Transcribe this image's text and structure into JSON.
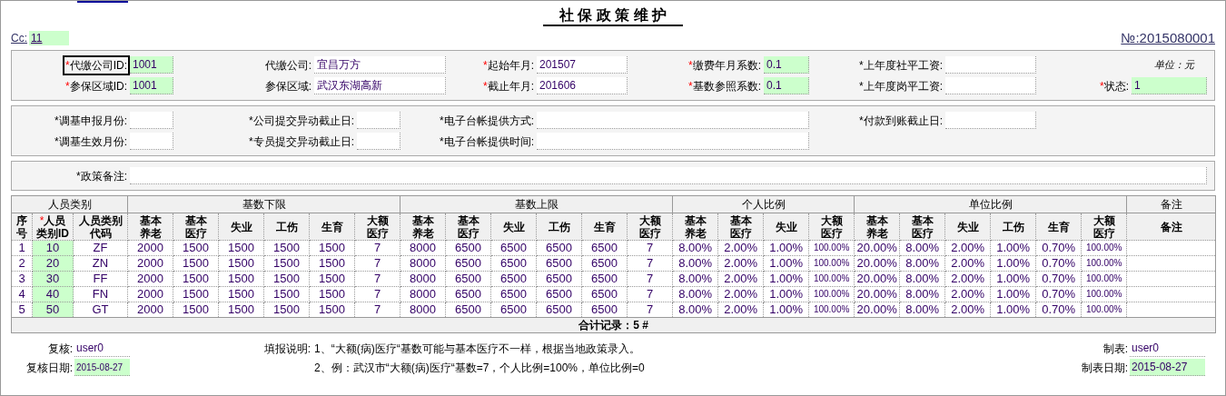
{
  "top_link_marker": true,
  "title": "社 保 政 策 维 护",
  "cc": {
    "label": "Cc:",
    "value": "11",
    "highlighted": true
  },
  "number": "№:2015080001",
  "sections": [
    {
      "unit_note": "单位：元",
      "rows": [
        [
          {
            "mark": "*",
            "required": true,
            "label": "代缴公司ID:",
            "value": "1001",
            "highlighted": true,
            "focused": true
          },
          {
            "label": "代缴公司:",
            "value": "宜昌万方",
            "highlighted": false,
            "focused": false
          },
          {
            "mark": "*",
            "required": true,
            "label": "起始年月:",
            "value": "201507",
            "highlighted": false,
            "focused": false
          },
          {
            "mark": "*",
            "required": true,
            "label": "缴费年月系数:",
            "value": "0.1",
            "highlighted": true,
            "focused": false
          },
          {
            "mark": "*",
            "required": false,
            "label": "上年度社平工资:",
            "highlighted": false,
            "focused": false
          }
        ],
        [
          {
            "mark": "*",
            "required": true,
            "label": "参保区域ID:",
            "value": "1001",
            "highlighted": true,
            "focused": false
          },
          {
            "label": "参保区域:",
            "value": "武汉东湖高新",
            "highlighted": false,
            "focused": false
          },
          {
            "mark": "*",
            "required": true,
            "label": "截止年月:",
            "value": "201606",
            "highlighted": false,
            "focused": false
          },
          {
            "mark": "*",
            "required": true,
            "label": "基数参照系数:",
            "value": "0.1",
            "highlighted": true,
            "focused": false
          },
          {
            "mark": "*",
            "required": false,
            "label": "上年度岗平工资:",
            "highlighted": false,
            "focused": false
          },
          {
            "mark": "*",
            "required": true,
            "label": "状态:",
            "value": "1",
            "highlighted": true,
            "focused": false
          }
        ]
      ]
    },
    {
      "rows": [
        [
          {
            "mark": "*",
            "required": false,
            "label": "调基申报月份:",
            "highlighted": false,
            "focused": false
          },
          {
            "mark": "*",
            "required": false,
            "label": "公司提交异动截止日:",
            "highlighted": false,
            "focused": false
          },
          {
            "mark": "*",
            "required": false,
            "label": "电子台帐提供方式:",
            "highlighted": false,
            "focused": false
          },
          {
            "mark": "*",
            "required": false,
            "label": "付款到账截止日:",
            "highlighted": false,
            "focused": false
          }
        ],
        [
          {
            "mark": "*",
            "required": false,
            "label": "调基生效月份:",
            "highlighted": false,
            "focused": false
          },
          {
            "mark": "*",
            "required": false,
            "label": "专员提交异动截止日:",
            "highlighted": false,
            "focused": false
          },
          {
            "mark": "*",
            "required": false,
            "label": "电子台帐提供时间:",
            "highlighted": false,
            "focused": false
          }
        ]
      ]
    },
    {
      "rows": [
        [
          {
            "mark": "*",
            "required": false,
            "label": "政策备注:",
            "highlighted": false,
            "focused": false
          }
        ]
      ]
    }
  ],
  "table": {
    "groups": [
      {
        "label": "人员类别"
      },
      {
        "label": "基数下限"
      },
      {
        "label": "基数上限"
      },
      {
        "label": "个人比例"
      },
      {
        "label": "单位比例"
      },
      {
        "label": "备注"
      }
    ],
    "columns": [
      {
        "label": "序号",
        "highlighted": false
      },
      {
        "mark": "*",
        "label": "人员类别ID",
        "highlighted": true
      },
      {
        "label": "人员类别代码",
        "highlighted": false
      },
      {
        "label": "基本养老",
        "highlighted": false
      },
      {
        "label": "基本医疗",
        "highlighted": false
      },
      {
        "label": "失业",
        "highlighted": false
      },
      {
        "label": "工伤",
        "highlighted": false
      },
      {
        "label": "生育",
        "highlighted": false
      },
      {
        "label": "大额医疗",
        "highlighted": false
      },
      {
        "label": "基本养老",
        "highlighted": false
      },
      {
        "label": "基本医疗",
        "highlighted": false
      },
      {
        "label": "失业",
        "highlighted": false
      },
      {
        "label": "工伤",
        "highlighted": false
      },
      {
        "label": "生育",
        "highlighted": false
      },
      {
        "label": "大额医疗",
        "highlighted": false
      },
      {
        "label": "基本养老",
        "highlighted": false
      },
      {
        "label": "基本医疗",
        "highlighted": false
      },
      {
        "label": "失业",
        "highlighted": false
      },
      {
        "label": "大额医疗",
        "highlighted": false
      },
      {
        "label": "基本养老",
        "highlighted": false
      },
      {
        "label": "基本医疗",
        "highlighted": false
      },
      {
        "label": "失业",
        "highlighted": false
      },
      {
        "label": "工伤",
        "highlighted": false
      },
      {
        "label": "生育",
        "highlighted": false
      },
      {
        "label": "大额医疗",
        "highlighted": false
      },
      {
        "label": "备注",
        "highlighted": false
      }
    ],
    "rows": [
      [
        "1",
        "10",
        "ZF",
        "2000",
        "1500",
        "1500",
        "1500",
        "1500",
        "7",
        "8000",
        "6500",
        "6500",
        "6500",
        "6500",
        "7",
        "8.00%",
        "2.00%",
        "1.00%",
        "100.00%",
        "20.00%",
        "8.00%",
        "2.00%",
        "1.00%",
        "0.70%",
        "100.00%"
      ],
      [
        "2",
        "20",
        "ZN",
        "2000",
        "1500",
        "1500",
        "1500",
        "1500",
        "7",
        "8000",
        "6500",
        "6500",
        "6500",
        "6500",
        "7",
        "8.00%",
        "2.00%",
        "1.00%",
        "100.00%",
        "20.00%",
        "8.00%",
        "2.00%",
        "1.00%",
        "0.70%",
        "100.00%"
      ],
      [
        "3",
        "30",
        "FF",
        "2000",
        "1500",
        "1500",
        "1500",
        "1500",
        "7",
        "8000",
        "6500",
        "6500",
        "6500",
        "6500",
        "7",
        "8.00%",
        "2.00%",
        "1.00%",
        "100.00%",
        "20.00%",
        "8.00%",
        "2.00%",
        "1.00%",
        "0.70%",
        "100.00%"
      ],
      [
        "4",
        "40",
        "FN",
        "2000",
        "1500",
        "1500",
        "1500",
        "1500",
        "7",
        "8000",
        "6500",
        "6500",
        "6500",
        "6500",
        "7",
        "8.00%",
        "2.00%",
        "1.00%",
        "100.00%",
        "20.00%",
        "8.00%",
        "2.00%",
        "1.00%",
        "0.70%",
        "100.00%"
      ],
      [
        "5",
        "50",
        "GT",
        "2000",
        "1500",
        "1500",
        "1500",
        "1500",
        "7",
        "8000",
        "6500",
        "6500",
        "6500",
        "6500",
        "7",
        "8.00%",
        "2.00%",
        "1.00%",
        "100.00%",
        "20.00%",
        "8.00%",
        "2.00%",
        "1.00%",
        "0.70%",
        "100.00%"
      ]
    ],
    "footer": "合计记录：5 #"
  },
  "bottom": {
    "reviewer": {
      "label": "复核:",
      "value": "user0",
      "highlighted": false
    },
    "review_date": {
      "label": "复核日期:",
      "value": "2015-08-27",
      "highlighted": true
    },
    "notes": {
      "label": "填报说明:",
      "lines": [
        "1、“大额(病)医疗“基数可能与基本医疗不一样，根据当地政策录入。",
        "2、例：武汉市“大额(病)医疗“基数=7，个人比例=100%，单位比例=0"
      ]
    },
    "maker": {
      "label": "制表:",
      "value": "user0",
      "highlighted": false
    },
    "make_date": {
      "label": "制表日期:",
      "value": "2015-08-27",
      "highlighted": true
    }
  }
}
